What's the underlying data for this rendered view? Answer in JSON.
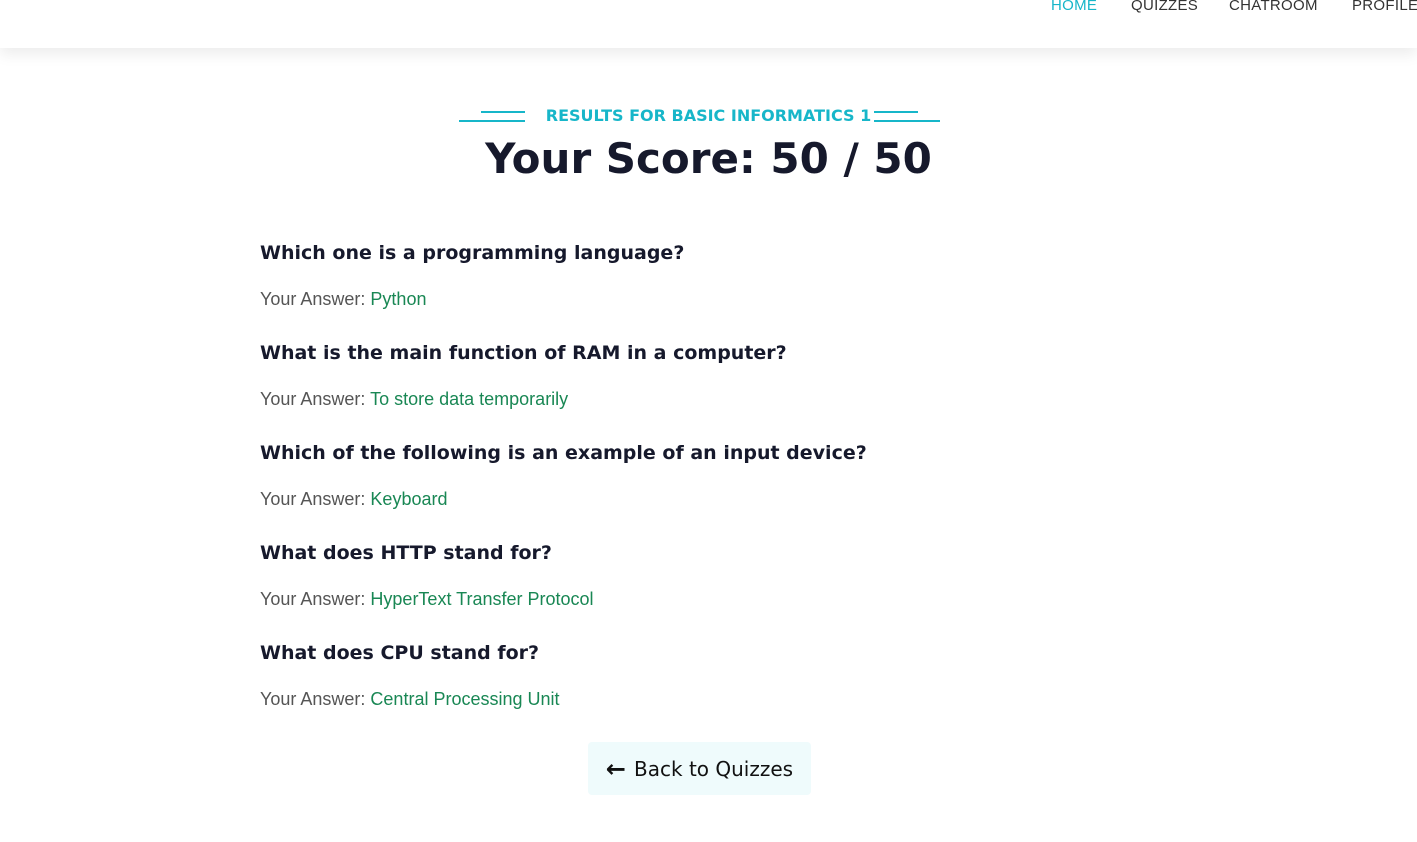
{
  "nav": {
    "items": [
      {
        "label": "HOME",
        "active": true
      },
      {
        "label": "QUIZZES"
      },
      {
        "label": "CHATROOM"
      },
      {
        "label": "PROFILE"
      }
    ]
  },
  "header": {
    "subtitle": "RESULTS FOR BASIC INFORMATICS 1",
    "score": "Your Score: 50 / 50"
  },
  "answer_prefix": "Your Answer:",
  "questions": [
    {
      "q": "Which one is a programming language?",
      "a": "Python"
    },
    {
      "q": "What is the main function of RAM in a computer?",
      "a": "To store data temporarily"
    },
    {
      "q": "Which of the following is an example of an input device?",
      "a": "Keyboard"
    },
    {
      "q": "What does HTTP stand for?",
      "a": "HyperText Transfer Protocol"
    },
    {
      "q": "What does CPU stand for?",
      "a": "Central Processing Unit"
    }
  ],
  "back_button": {
    "label": "Back to Quizzes",
    "icon": "arrow-left-icon"
  },
  "colors": {
    "accent": "#17b6c9",
    "answer": "#198754",
    "text": "#16192c"
  }
}
